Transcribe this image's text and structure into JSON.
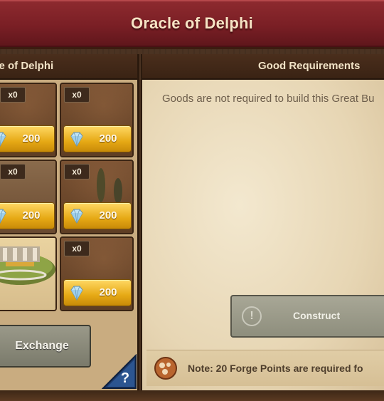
{
  "window": {
    "title": "Oracle of Delphi"
  },
  "left_panel": {
    "header": "cle of Delphi",
    "slots": [
      {
        "count": "x0",
        "price": "200"
      },
      {
        "count": "x0",
        "price": "200"
      },
      {
        "count": "x0",
        "price": "200"
      },
      {
        "count": "x0",
        "price": "200"
      },
      {
        "count": "",
        "price": ""
      },
      {
        "count": "x0",
        "price": "200"
      }
    ],
    "exchange_label": "Exchange",
    "help_label": "?"
  },
  "right_panel": {
    "header": "Good Requirements",
    "goods_text": "Goods are not required to build this Great Bu",
    "construct_label": "Construct",
    "note": "Note: 20 Forge Points are required fo"
  },
  "icons": {
    "price": "diamond-icon",
    "construct": "warning-icon",
    "note": "forge-points-icon",
    "help": "help-icon"
  },
  "colors": {
    "title_bar": "#7a1f25",
    "price_button": "#e6a915",
    "disabled_button": "#8e8e7d",
    "help_button": "#1d3a6b"
  }
}
